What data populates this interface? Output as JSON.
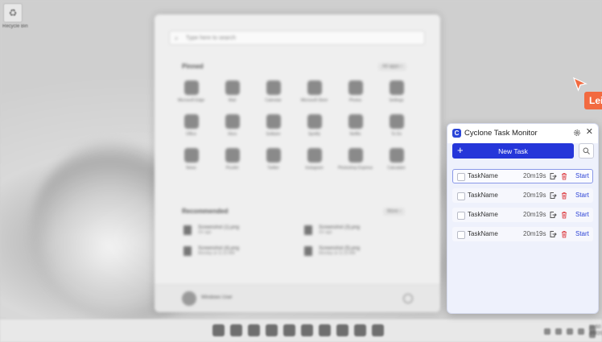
{
  "desktop": {
    "icon_label": "Recycle Bin"
  },
  "start_menu": {
    "search_placeholder": "Type here to search",
    "pinned_label": "Pinned",
    "all_apps_label": "All apps  ›",
    "apps": [
      "Microsoft Edge",
      "Mail",
      "Calendar",
      "Microsoft Store",
      "Photos",
      "Settings",
      "Office",
      "Xbox",
      "Solitaire",
      "Spotify",
      "Netflix",
      "To Do",
      "News",
      "PicsArt",
      "Twitter",
      "Instagram",
      "Photoshop Express",
      "Calculator"
    ],
    "recommended_label": "Recommended",
    "more_label": "More  ›",
    "recommended": [
      {
        "name": "Screenshot (1).png",
        "time": "2m ago"
      },
      {
        "name": "Screenshot (3).png",
        "time": "2m ago"
      },
      {
        "name": "Screenshot (4).png",
        "time": "Monday at 11:22 AM"
      },
      {
        "name": "Screenshot (5).png",
        "time": "Monday at 11:22 AM"
      }
    ],
    "user_name": "Windows User"
  },
  "taskbar": {
    "clock_time": "11:50 AM",
    "clock_date": "1/1/2024"
  },
  "side_tag": "Lei",
  "panel": {
    "logo_letter": "C",
    "title": "Cyclone Task Monitor",
    "new_task_label": "New Task",
    "tasks": [
      {
        "name": "TaskName",
        "time": "20m19s",
        "action": "Start"
      },
      {
        "name": "TaskName",
        "time": "20m19s",
        "action": "Start"
      },
      {
        "name": "TaskName",
        "time": "20m19s",
        "action": "Start"
      },
      {
        "name": "TaskName",
        "time": "20m19s",
        "action": "Start"
      }
    ],
    "colors": {
      "accent": "#2536d9",
      "delete": "#e0565b",
      "background": "#eef1fc"
    }
  }
}
